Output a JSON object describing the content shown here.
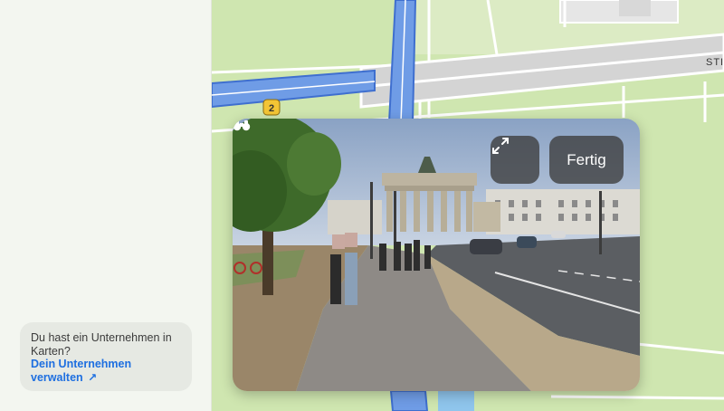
{
  "sidebar": {
    "business_prompt": "Du hast ein Unternehmen in Karten?",
    "manage_link_line1": "Dein Unternehmen",
    "manage_link_line2": "verwalten",
    "manage_link_arrow": "↗"
  },
  "map": {
    "road_shield_number": "2",
    "street_label_partial": "STI",
    "colors": {
      "park": "#cfe6b0",
      "road": "#ffffff",
      "highway": "#6f9ce6",
      "highway_outline": "#3f6fcf",
      "building": "#e2e2e2"
    }
  },
  "look_around": {
    "done_label": "Fertig",
    "expand_icon": "expand-arrows-icon",
    "binoculars_icon": "binoculars-icon"
  }
}
